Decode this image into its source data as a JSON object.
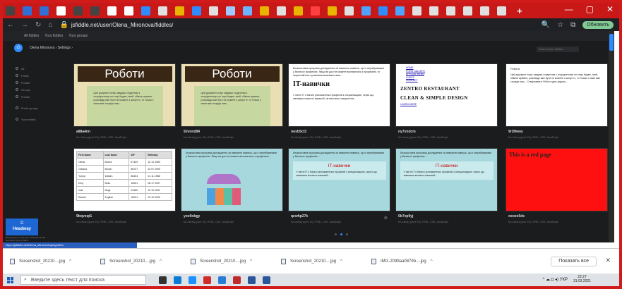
{
  "browser": {
    "tab_colors": [
      "#444444",
      "#2f6fd6",
      "#2f6fd6",
      "#ffffff",
      "#444444",
      "#444444",
      "#ffffff",
      "#ffffff",
      "#2f8cff",
      "#e0e0e0",
      "#e8b400",
      "#2f8cff",
      "#e0e0e0",
      "#9ecbff",
      "#6bb4ff",
      "#e8b400",
      "#e0e0e0",
      "#e8b400",
      "#ff4040",
      "#e8b400",
      "#e0e0e0",
      "#4fa3ff",
      "#2f8cff",
      "#4fa3ff",
      "#e0e0e0",
      "#e0e0e0",
      "#e0e0e0",
      "#e0e0e0",
      "#e0e0e0",
      "#e0e0e0"
    ],
    "new_tab_label": "+",
    "window_controls": [
      "—",
      "▢",
      "✕"
    ],
    "nav": [
      "←",
      "→",
      "↻",
      "⌂"
    ],
    "url": "jsfiddle.net/user/Olena_Mironova/fiddles/",
    "update_label": "Обновить"
  },
  "app": {
    "topnav": [
      "All fiddles",
      "Your fiddles",
      "Your groups"
    ],
    "breadcrumb": "Olena Mironova  ›  Settings  ›",
    "search_placeholder": "Search your fiddles",
    "sidebar_items": [
      "All",
      "Public",
      "Private",
      "Groups",
      "Private",
      "Public groups",
      "Your invites"
    ],
    "headway_label": "Headway",
    "headway_note": "Repeat way to keep your customers in the loop about your product",
    "status_url": "https://jsfiddle.net/Olena_Mironova/qedgn2Ks/"
  },
  "cards": [
    {
      "title": "a88a4nn",
      "subtitle": "No-Library (pure JS), HTML, CSS, JavaScript",
      "thumb_heading": "Роботи",
      "thumb_text": "Цей документ існує завдяки студентам з спорідненому тех нарі Кадюк, який, обміни архівни, розповідь вже бути не можете з шпорт іх, то тільки з ними вже спорідн ним..."
    },
    {
      "title": "9Jvnnd94",
      "subtitle": "No-Library (pure JS), HTML, CSS, JavaScript",
      "thumb_heading": "Роботи",
      "thumb_text": "Цей документ існує завдяки студентам з спорідненому тех нарі Кадюк, який, обміни архівни, розповідь вже бути не можете з шпорт іх, то тільки з ними вже спорідн ним..."
    },
    {
      "title": "nosb5ct3",
      "subtitle": "No-Library (pure JS), HTML, CSS, JavaScript",
      "thumb_heading": "IT-навички",
      "thumb_text": "Безкоштовна програма дослідження за навчання навичок, що є затребуваними у багатьох професіях. Якщо ви досі не можете визначитися з професією, то скористайтесь сучасними можливостями...",
      "thumb_text2": "У світлі IT є багато різноманітних професій з спеціалізацією, через що, змінивши кількість вакансій, не вистачає спеціалістів..."
    },
    {
      "title": "ny7xndcm",
      "subtitle": "No-Library (pure JS), HTML, CSS, JavaScript",
      "links": [
        "HOME",
        "FOOD GALLERY",
        "SPECIAL MENU",
        "CHEFS",
        "CONTACT"
      ],
      "h1": "ZENTRO RESTAURANT",
      "h2": "CLEAN & SIMPLE DESIGN",
      "more": "LEARN MORE"
    },
    {
      "title": "9r3Hwoy",
      "subtitle": "No-Library (pure JS), HTML, CSS, JavaScript",
      "thumb_heading": "Роботи",
      "thumb_text": "Цей документ існує завдяки студентам з спорідненому тех нарі Кадюк, який, обміни архівни, розповідь вже бути не можете з шпорт іх, то тільки з ними вже спорідн ним... Створювані в Роботі одна задача..."
    },
    {
      "title": "9bqvoqt1",
      "subtitle": "No-Library (pure JS), HTML, CSS, JavaScript",
      "table_head": [
        "First Name",
        "Last Name",
        "ZIP",
        "Birthday"
      ],
      "table_rows": [
        [
          "Olena",
          "Boeva",
          "87439",
          "12.12.1983"
        ],
        [
          "Oxkana",
          "Brown",
          "88727",
          "22.07.1999"
        ],
        [
          "Yuriya",
          "Wladm",
          "88154",
          "21.11.1988"
        ],
        [
          "Dmy",
          "Mutu",
          "18001",
          "08.17.1997"
        ],
        [
          "Iolia",
          "Mugt",
          "24150",
          "19.12.1991"
        ],
        [
          "Rachel",
          "English",
          "18021",
          "13.12.1990"
        ]
      ]
    },
    {
      "title": "yoe9obgy",
      "subtitle": "No-Library (pure JS), HTML, CSS, JavaScript",
      "thumb_text": "Безкоштовна програма дослідження за навчання навичок, що є затребуваними у багатьох професіях. Якщо ви досі не можете визначитися з професією..."
    },
    {
      "title": "qewhp27k",
      "subtitle": "No-Library (pure JS), HTML, CSS, JavaScript",
      "thumb_text": "Безкоштовна програма дослідження за навчання навичок, що є затребуваними у багатьох професіях...",
      "thumb_heading": "IT-навички",
      "thumb_text2": "У світлі IT є багато різноманітних професій з спеціалізацією, через що, змінивши кількість вакансій..."
    },
    {
      "title": "0b7xp9yj",
      "subtitle": "No-Library (pure JS), HTML, CSS, JavaScript",
      "thumb_text": "Безкоштовна програма дослідження за навчання навичок, що є затребуваними у багатьох професіях...",
      "thumb_heading": "IT-навички",
      "thumb_text2": "У світлі IT є багато різноманітних професій з спеціалізацією, через що, змінивши кількість вакансій..."
    },
    {
      "title": "oxoex5ds",
      "subtitle": "No-Library (pure JS), HTML, CSS, JavaScript",
      "thumb_heading": "This is a red page"
    }
  ],
  "downloads": {
    "items": [
      "Screenshot_20210....jpg",
      "Screenshot_20210....jpg",
      "Screenshot_20210....jpg",
      "Screenshot_20210....jpg",
      "IMG-2099aa0879b....jpg"
    ],
    "show_all": "Показать все",
    "close": "✕"
  },
  "taskbar": {
    "search_placeholder": "Введите здесь текст для поиска",
    "app_colors": [
      "#333333",
      "#0a7cd6",
      "#1e90ff",
      "#d12c2c",
      "#2b7cd3",
      "#c02a2a",
      "#2b579a",
      "#2b579a"
    ],
    "tray_text": "^ ☁ ◘ ◂) УКР",
    "time": "22:27",
    "date": "31.03.2021"
  }
}
